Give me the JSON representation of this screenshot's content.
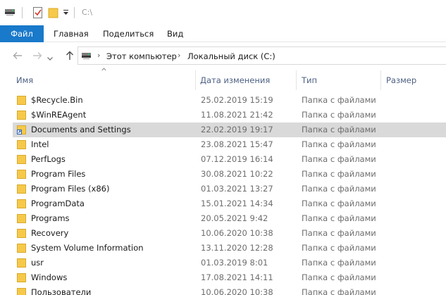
{
  "titlebar": {
    "path_text": "C:\\"
  },
  "ribbon": {
    "tabs": [
      "Файл",
      "Главная",
      "Поделиться",
      "Вид"
    ]
  },
  "address": {
    "crumbs": [
      "Этот компьютер",
      "Локальный диск (C:)"
    ]
  },
  "columns": {
    "name": "Имя",
    "date": "Дата изменения",
    "type": "Тип",
    "size": "Размер"
  },
  "colors": {
    "accent": "#1979ca",
    "folder": "#f6c94b",
    "selected_row": "#d9d9d9"
  },
  "files": [
    {
      "name": "$Recycle.Bin",
      "date": "25.02.2019 15:19",
      "type": "Папка с файлами",
      "icon": "folder-icon"
    },
    {
      "name": "$WinREAgent",
      "date": "11.08.2021 21:42",
      "type": "Папка с файлами",
      "icon": "folder-icon"
    },
    {
      "name": "Documents and Settings",
      "date": "22.02.2019 19:17",
      "type": "Папка с файлами",
      "icon": "folder-shortcut-icon",
      "selected": true
    },
    {
      "name": "Intel",
      "date": "23.08.2021 15:47",
      "type": "Папка с файлами",
      "icon": "folder-icon"
    },
    {
      "name": "PerfLogs",
      "date": "07.12.2019 16:14",
      "type": "Папка с файлами",
      "icon": "folder-icon"
    },
    {
      "name": "Program Files",
      "date": "30.08.2021 10:22",
      "type": "Папка с файлами",
      "icon": "folder-icon"
    },
    {
      "name": "Program Files (x86)",
      "date": "01.03.2021 13:27",
      "type": "Папка с файлами",
      "icon": "folder-icon"
    },
    {
      "name": "ProgramData",
      "date": "15.01.2021 14:34",
      "type": "Папка с файлами",
      "icon": "folder-icon"
    },
    {
      "name": "Programs",
      "date": "20.05.2021 9:42",
      "type": "Папка с файлами",
      "icon": "folder-icon"
    },
    {
      "name": "Recovery",
      "date": "10.06.2020 10:38",
      "type": "Папка с файлами",
      "icon": "folder-icon"
    },
    {
      "name": "System Volume Information",
      "date": "13.11.2020 12:28",
      "type": "Папка с файлами",
      "icon": "folder-icon"
    },
    {
      "name": "usr",
      "date": "01.03.2019 8:01",
      "type": "Папка с файлами",
      "icon": "folder-icon"
    },
    {
      "name": "Windows",
      "date": "17.08.2021 14:11",
      "type": "Папка с файлами",
      "icon": "folder-icon"
    },
    {
      "name": "Пользователи",
      "date": "10.06.2020 10:38",
      "type": "Папка с файлами",
      "icon": "folder-icon"
    }
  ]
}
